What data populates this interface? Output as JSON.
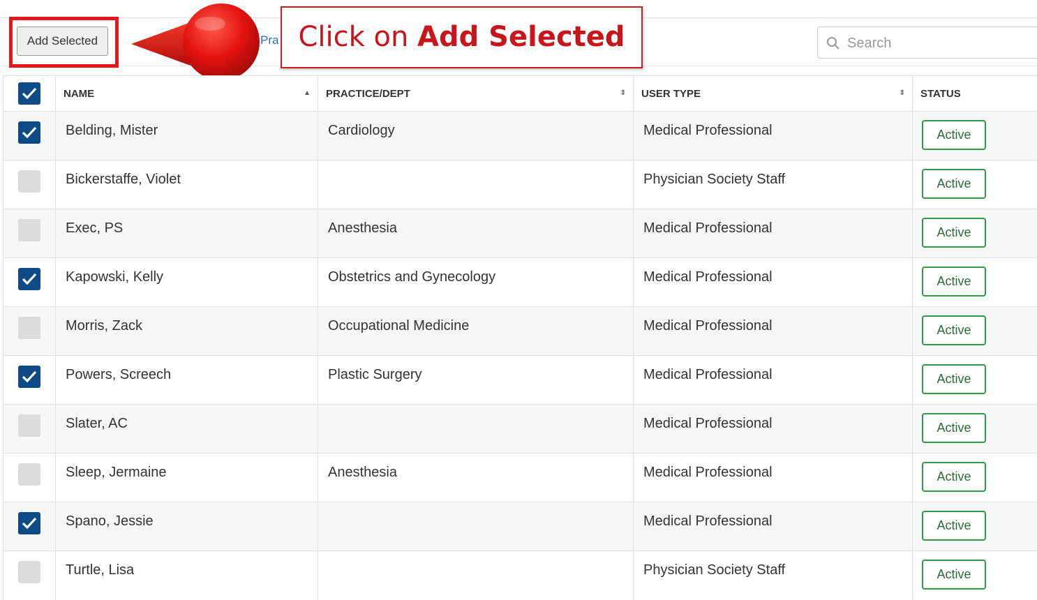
{
  "toolbar": {
    "add_selected_label": "Add Selected",
    "partial_link_text": "Pra",
    "search_placeholder": "Search"
  },
  "callout": {
    "prefix": "Click on ",
    "emphasis": "Add Selected"
  },
  "colors": {
    "highlight_red": "#e8151b",
    "checkbox_checked": "#0d4a86",
    "status_green": "#2e9a4a"
  },
  "table": {
    "columns": [
      {
        "label": "NAME",
        "sort": "ascending"
      },
      {
        "label": "PRACTICE/DEPT",
        "sort": "unsorted"
      },
      {
        "label": "USER TYPE",
        "sort": "unsorted"
      },
      {
        "label": "STATUS",
        "sort": "none"
      }
    ],
    "header_checked": true,
    "rows": [
      {
        "checked": true,
        "name": "Belding, Mister",
        "practice": "Cardiology",
        "user_type": "Medical Professional",
        "status": "Active"
      },
      {
        "checked": false,
        "name": "Bickerstaffe, Violet",
        "practice": "",
        "user_type": "Physician Society Staff",
        "status": "Active"
      },
      {
        "checked": false,
        "name": "Exec, PS",
        "practice": "Anesthesia",
        "user_type": "Medical Professional",
        "status": "Active"
      },
      {
        "checked": true,
        "name": "Kapowski, Kelly",
        "practice": "Obstetrics and Gynecology",
        "user_type": "Medical Professional",
        "status": "Active"
      },
      {
        "checked": false,
        "name": "Morris, Zack",
        "practice": "Occupational Medicine",
        "user_type": "Medical Professional",
        "status": "Active"
      },
      {
        "checked": true,
        "name": "Powers, Screech",
        "practice": "Plastic Surgery",
        "user_type": "Medical Professional",
        "status": "Active"
      },
      {
        "checked": false,
        "name": "Slater, AC",
        "practice": "",
        "user_type": "Medical Professional",
        "status": "Active"
      },
      {
        "checked": false,
        "name": "Sleep, Jermaine",
        "practice": "Anesthesia",
        "user_type": "Medical Professional",
        "status": "Active"
      },
      {
        "checked": true,
        "name": "Spano, Jessie",
        "practice": "",
        "user_type": "Medical Professional",
        "status": "Active"
      },
      {
        "checked": false,
        "name": "Turtle, Lisa",
        "practice": "",
        "user_type": "Physician Society Staff",
        "status": "Active"
      }
    ]
  }
}
